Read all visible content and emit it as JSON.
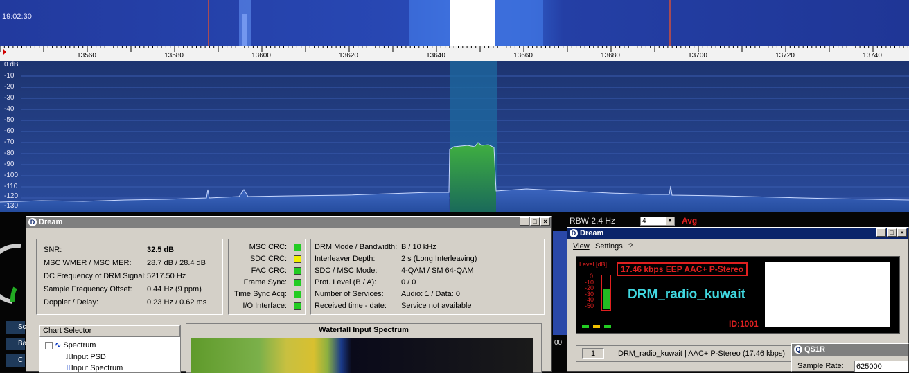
{
  "sdr": {
    "waterfall_time": "19:02:30",
    "freq_ticks": [
      "13560",
      "13580",
      "13600",
      "13620",
      "13640",
      "13660",
      "13680",
      "13700",
      "13720",
      "13740"
    ],
    "db_labels": [
      "0 dB",
      "-10",
      "-20",
      "-30",
      "-40",
      "-50",
      "-60",
      "-70",
      "-80",
      "-90",
      "-100",
      "-110",
      "-120",
      "-130"
    ],
    "rbw_label": "RBW  2.4 Hz",
    "avg_value": "4",
    "avg_label": "Avg",
    "side_buttons": [
      "Sc",
      "Ba",
      "C"
    ],
    "strip_label": "00"
  },
  "dream_main": {
    "title": "Dream",
    "stats": [
      {
        "label": "SNR:",
        "value": "32.5 dB"
      },
      {
        "label": "MSC WMER / MSC MER:",
        "value": "28.7 dB / 28.4 dB"
      },
      {
        "label": "DC Frequency of DRM Signal:",
        "value": "5217.50 Hz"
      },
      {
        "label": "Sample Frequency Offset:",
        "value": "0.44 Hz (9 ppm)"
      },
      {
        "label": "Doppler / Delay:",
        "value": "0.23 Hz / 0.62 ms"
      }
    ],
    "status": [
      {
        "label": "MSC CRC:",
        "color": "#22cc22"
      },
      {
        "label": "SDC CRC:",
        "color": "#f0f000"
      },
      {
        "label": "FAC CRC:",
        "color": "#22cc22"
      },
      {
        "label": "Frame Sync:",
        "color": "#22cc22"
      },
      {
        "label": "Time Sync Acq:",
        "color": "#22cc22"
      },
      {
        "label": "I/O Interface:",
        "color": "#22cc22"
      }
    ],
    "params": [
      {
        "label": "DRM Mode / Bandwidth:",
        "value": "B / 10 kHz"
      },
      {
        "label": "Interleaver Depth:",
        "value": "2 s (Long Interleaving)"
      },
      {
        "label": "SDC / MSC Mode:",
        "value": "4-QAM / SM 64-QAM"
      },
      {
        "label": "Prot. Level (B / A):",
        "value": "0 / 0"
      },
      {
        "label": "Number of Services:",
        "value": "Audio: 1 / Data: 0"
      },
      {
        "label": "Received time - date:",
        "value": "Service not available"
      }
    ],
    "chart_selector": {
      "header": "Chart Selector",
      "items": [
        "Spectrum",
        "Input PSD",
        "Input Spectrum"
      ]
    },
    "chart_title": "Waterfall Input Spectrum"
  },
  "dream_player": {
    "title": "Dream",
    "menu": [
      "View",
      "Settings",
      "?"
    ],
    "level_label": "Level [dB]",
    "level_ticks": [
      "0",
      "-10",
      "-20",
      "-30",
      "-40",
      "-50"
    ],
    "level_fraction": 0.62,
    "info": "17.46 kbps EEP  AAC+  P-Stereo",
    "station": "DRM_radio_kuwait",
    "id": "ID:1001",
    "service_index": "1",
    "service_text": "DRM_radio_kuwait  |  AAC+ P-Stereo (17.46 kbps)"
  },
  "qs1r": {
    "title": "QS1R",
    "sample_rate_label": "Sample Rate:",
    "sample_rate_value": "625000"
  }
}
